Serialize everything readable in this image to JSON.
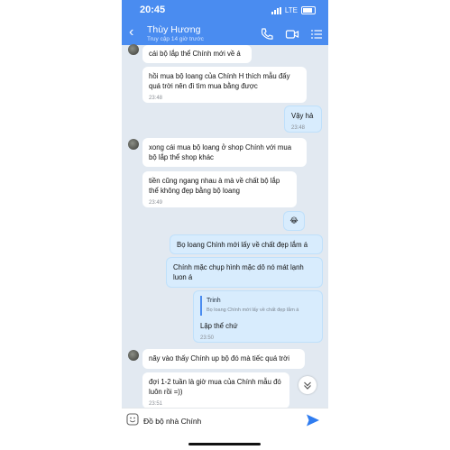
{
  "status_bar": {
    "time": "20:45",
    "network": "LTE"
  },
  "header": {
    "contact_name": "Thùy Hương",
    "last_seen": "Truy cập 14 giờ trước"
  },
  "messages": [
    {
      "text": "cái bộ lắp thể Chính mới về á"
    },
    {
      "text": "hồi mua bộ loang của Chính H thích mẫu đấy quá trời nên đi tìm mua bằng được",
      "time": "23:48"
    },
    {
      "text": "Vậy hả",
      "time": "23:48"
    },
    {
      "text": "xong cái mua bộ loang ở shop Chính với mua bộ lắp thể shop khác"
    },
    {
      "text": "tiền cũng ngang nhau à mà về chất bộ lắp thể không đẹp bằng bộ loang",
      "time": "23:49"
    },
    {
      "text": "😂"
    },
    {
      "text": "Bọ loang Chính mới lấy về chất đẹp lắm á"
    },
    {
      "text": "Chính mặc chụp hình mặc dô nó mát lạnh luon á"
    },
    {
      "quote_name": "Trinh",
      "quote_text": "Bọ loang Chính mới lấy về chất đẹp lắm á",
      "text": "Lập thể chứ",
      "time": "23:50"
    },
    {
      "text": "nãy vào thấy Chính up bộ đó mà tiếc quá trời"
    },
    {
      "text": "đợi 1-2 tuần là giờ mua của Chính mẫu đó luôn rồi =))",
      "time": "23:51"
    }
  ],
  "composer": {
    "value": "Đồ bộ nhà Chính"
  },
  "colors": {
    "header": "#4a8cf0",
    "outgoing_bubble": "#d8ecfd",
    "incoming_bubble": "#ffffff",
    "background": "#e2e9f1",
    "send": "#2f7cf0"
  }
}
